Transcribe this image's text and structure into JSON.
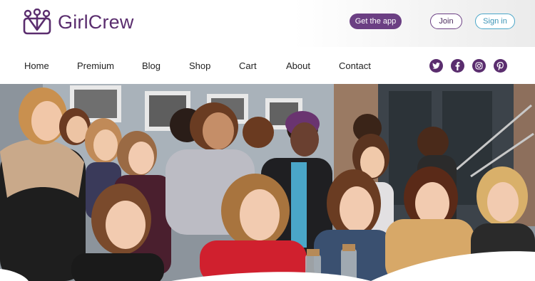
{
  "brand": {
    "name": "GirlCrew",
    "color": "#5a2d6e"
  },
  "header": {
    "get_app_label": "Get the app",
    "join_label": "Join",
    "signin_label": "Sign in"
  },
  "nav": {
    "items": [
      {
        "label": "Home"
      },
      {
        "label": "Premium"
      },
      {
        "label": "Blog"
      },
      {
        "label": "Shop"
      },
      {
        "label": "Cart"
      },
      {
        "label": "About"
      },
      {
        "label": "Contact"
      }
    ]
  },
  "social": [
    "twitter-icon",
    "facebook-icon",
    "instagram-icon",
    "pinterest-icon"
  ],
  "hero": {
    "image": "group-photo"
  },
  "colors": {
    "brand_purple": "#6b3f83",
    "signin_blue": "#4aa6c8"
  }
}
